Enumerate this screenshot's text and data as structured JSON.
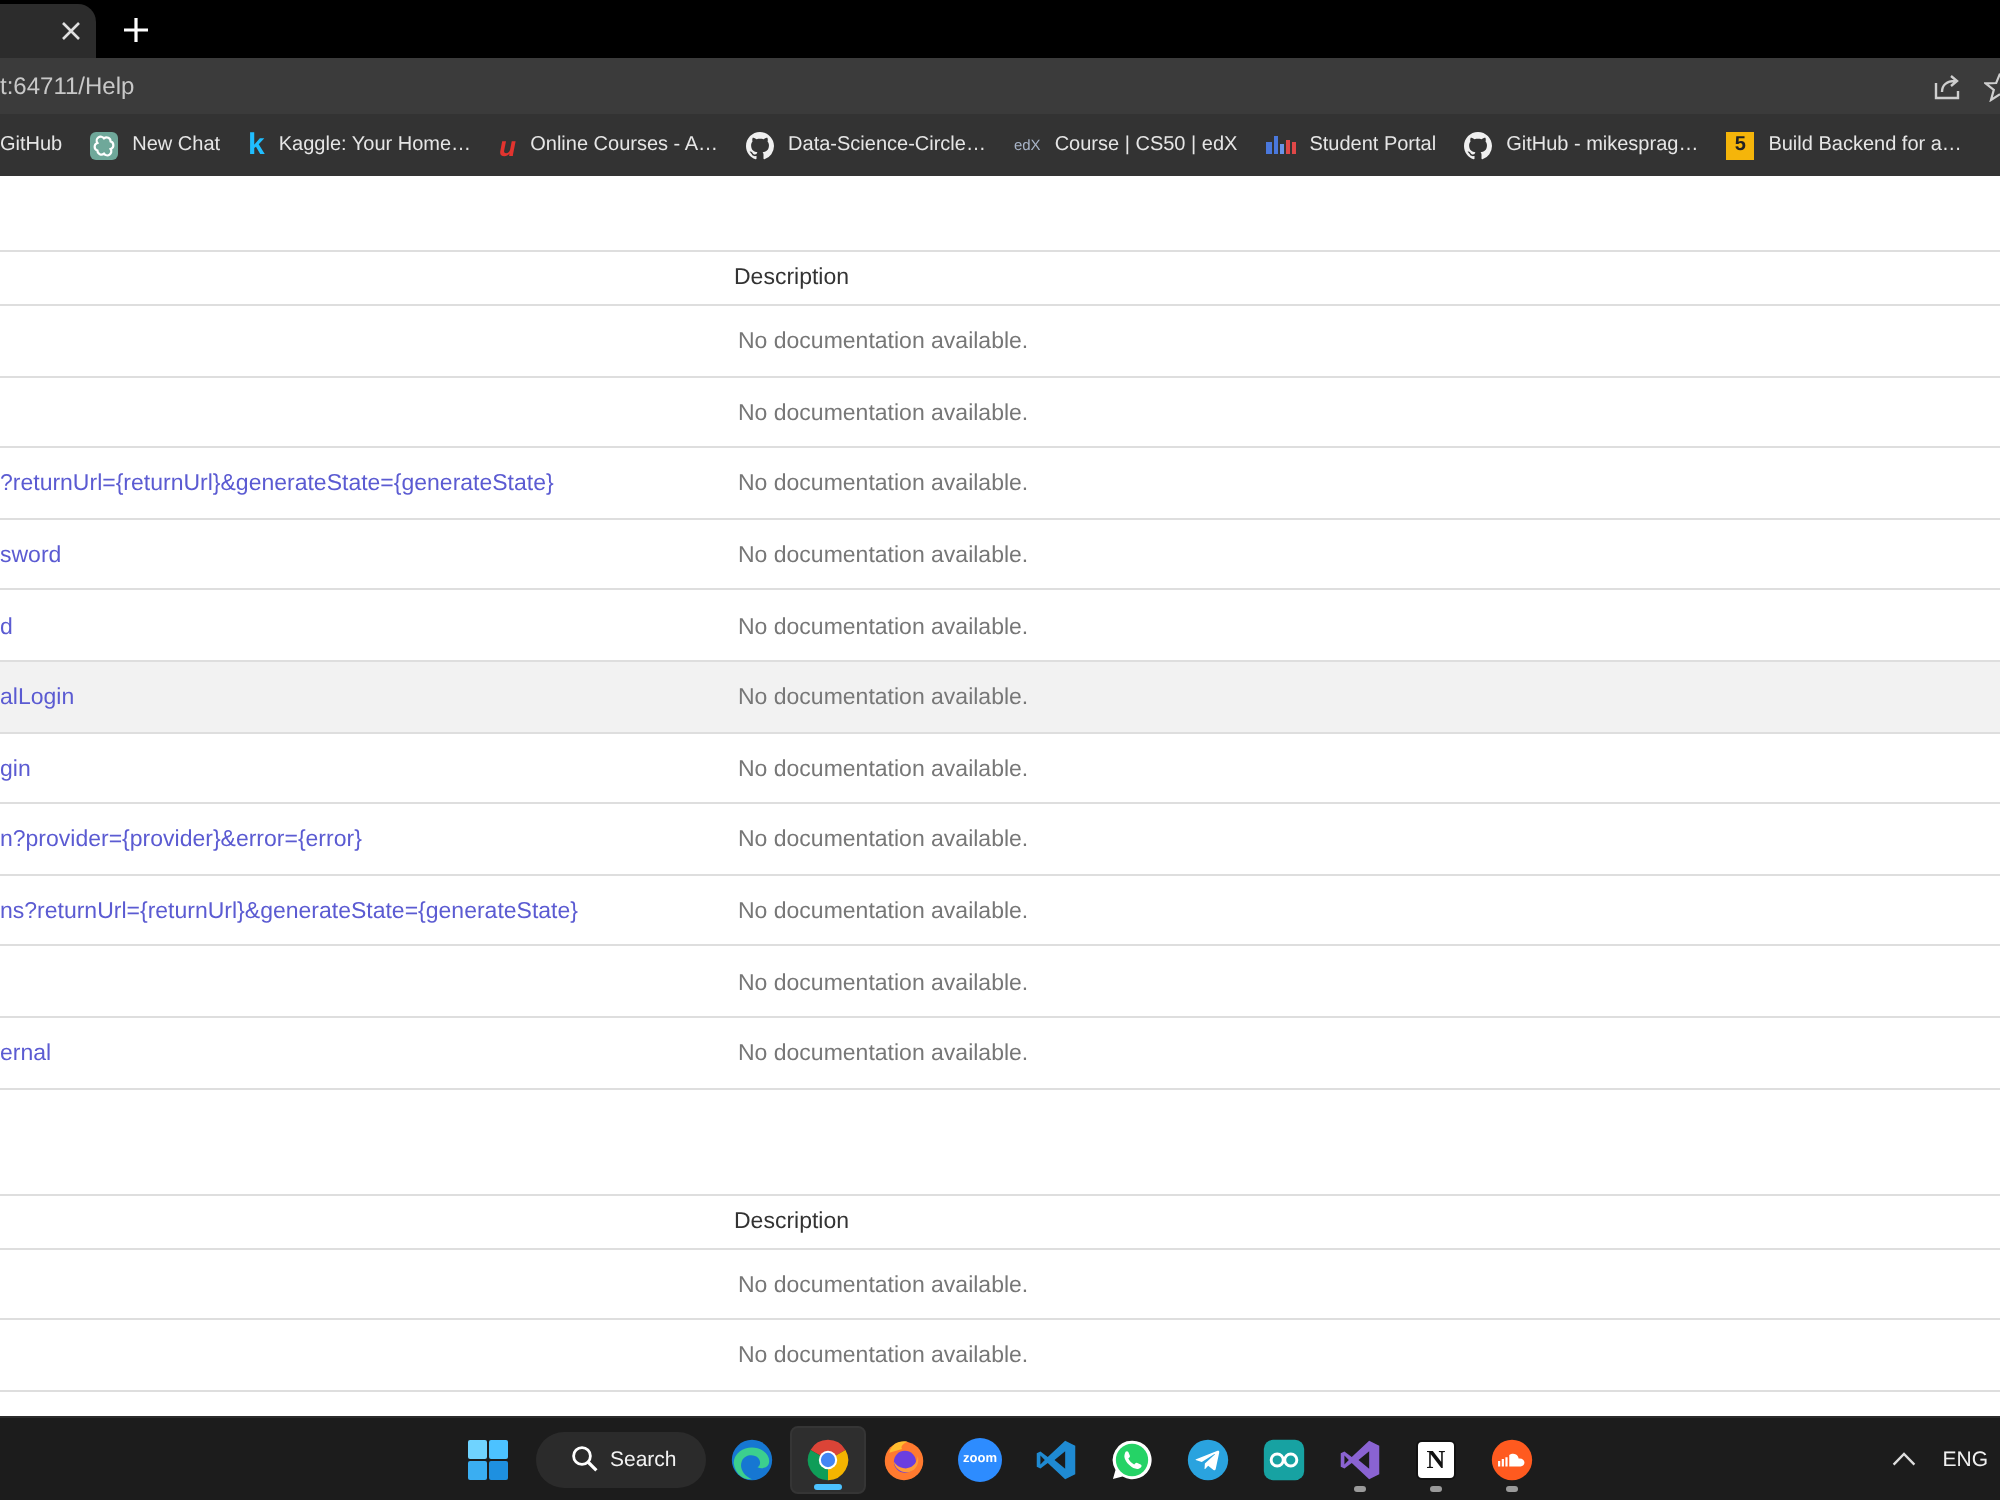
{
  "browser": {
    "tab": {
      "selected": true
    },
    "address": "t:64711/Help",
    "bookmarks": [
      {
        "label": "GitHub",
        "kind": "none"
      },
      {
        "label": "New Chat",
        "kind": "knot"
      },
      {
        "label": "Kaggle: Your Home…",
        "kind": "plain-letter",
        "icon_text": "k"
      },
      {
        "label": "Online Courses - A…",
        "kind": "script-letter",
        "icon_text": "u"
      },
      {
        "label": "Data-Science-Circle…",
        "kind": "octocat"
      },
      {
        "label": "Course | CS50 | edX",
        "kind": "wordmark",
        "icon_text": "edX"
      },
      {
        "label": "Student Portal",
        "kind": "portal"
      },
      {
        "label": "GitHub - mikesprag…",
        "kind": "octocat"
      },
      {
        "label": "Build Backend for a…",
        "kind": "tile",
        "icon_text": "5"
      }
    ]
  },
  "tables": [
    {
      "header": "Description",
      "rows": [
        {
          "description": "No documentation available.",
          "highlighted": false
        },
        {
          "description": "No documentation available.",
          "highlighted": false
        },
        {
          "api": "?returnUrl={returnUrl}&generateState={generateState}",
          "description": "No documentation available.",
          "highlighted": false
        },
        {
          "api": "sword",
          "description": "No documentation available.",
          "highlighted": false
        },
        {
          "api": "d",
          "description": "No documentation available.",
          "highlighted": false
        },
        {
          "api": "alLogin",
          "description": "No documentation available.",
          "highlighted": true
        },
        {
          "api": "gin",
          "description": "No documentation available.",
          "highlighted": false
        },
        {
          "api": "n?provider={provider}&error={error}",
          "description": "No documentation available.",
          "highlighted": false
        },
        {
          "api": "ns?returnUrl={returnUrl}&generateState={generateState}",
          "description": "No documentation available.",
          "highlighted": false
        },
        {
          "description": "No documentation available.",
          "highlighted": false
        },
        {
          "api": "ernal",
          "description": "No documentation available.",
          "highlighted": false
        }
      ]
    },
    {
      "header": "Description",
      "rows": [
        {
          "description": "No documentation available.",
          "highlighted": false
        },
        {
          "description": "No documentation available.",
          "highlighted": false
        }
      ]
    }
  ],
  "taskbar": {
    "search": {
      "label": "Search"
    },
    "apps": [
      {
        "kind": "edge",
        "selected": false,
        "running": false
      },
      {
        "kind": "chrome",
        "selected": true,
        "running": true
      },
      {
        "kind": "firefox",
        "selected": false,
        "running": false
      },
      {
        "kind": "zoom",
        "icon_text": "zoom",
        "selected": false,
        "running": false
      },
      {
        "kind": "vscode",
        "selected": false,
        "running": false
      },
      {
        "kind": "whatsapp",
        "selected": false,
        "running": false
      },
      {
        "kind": "telegram",
        "selected": false,
        "running": false
      },
      {
        "kind": "arduino",
        "selected": false,
        "running": false
      },
      {
        "kind": "visualstudio",
        "selected": false,
        "running": true
      },
      {
        "kind": "notion",
        "icon_text": "N",
        "selected": false,
        "running": true
      },
      {
        "kind": "soundcloud",
        "selected": false,
        "running": true
      }
    ],
    "tray": {
      "language": "ENG"
    }
  }
}
